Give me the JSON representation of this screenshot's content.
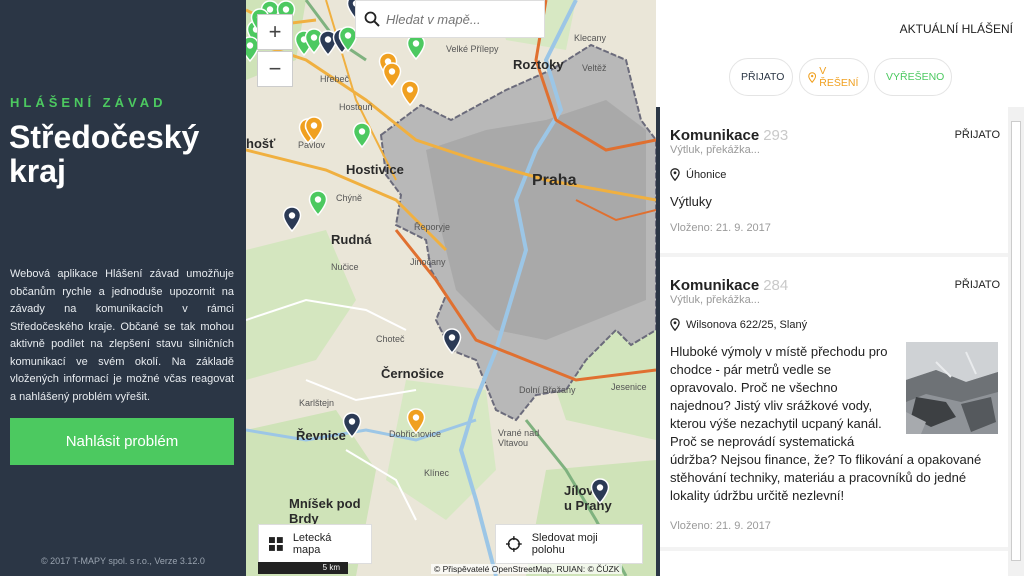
{
  "left": {
    "subtitle": "HLÁŠENÍ ZÁVAD",
    "title": "Středočeský kraj",
    "description": "Webová aplikace Hlášení závad umožňuje občanům rychle a jednoduše upozornit na závady na komunikacích v rámci Středočeského kraje. Občané se tak mohou aktivně podílet na zlepšení stavu silničních komunikací ve svém okolí. Na základě vložených informací je možné včas reagovat a nahlášený problém vyřešit.",
    "report_button": "Nahlásit problém",
    "footer": "© 2017 T-MAPY spol. s r.o., Verze 3.12.0"
  },
  "map": {
    "search_placeholder": "Hledat v mapě...",
    "zoom_in": "+",
    "zoom_out": "−",
    "aerial_button": "Letecká mapa",
    "locate_button": "Sledovat moji polohu",
    "scale": "5 km",
    "attribution": "© Přispěvatelé OpenStreetMap, RUIAN: © ČÚZK",
    "labels": {
      "praha": "Praha",
      "roztoky": "Roztoky",
      "hostivice": "Hostivice",
      "rudna": "Rudná",
      "cernosice": "Černošice",
      "revnice": "Řevnice",
      "mnisek": "Mníšek pod Brdy",
      "jilove": "Jílové u Prahy",
      "hostoun": "hošť",
      "klecany": "Klecany",
      "veltez": "Veltěž",
      "hrebec": "Hřebeč",
      "pavlov": "Pavlov",
      "chyne": "Chýně",
      "nucice": "Nučice",
      "jinocany": "Jinočany",
      "chotec": "Choteč",
      "karlstejn": "Karlštejn",
      "dobrichovice": "Dobřichovice",
      "vrane": "Vrané nad Vltavou",
      "klinec": "Klínec",
      "jesenice": "Jesenice",
      "dolni_brezany": "Dolní Břežany",
      "hostivice_small": "Hostouň",
      "velke_prilepy": "Velké Přílepy",
      "drastany": "Řeporyje"
    }
  },
  "right": {
    "header": "AKTUÁLNÍ HLÁŠENÍ",
    "filters": {
      "prijato": "PŘIJATO",
      "v_reseni": "V ŘEŠENÍ",
      "vyreseno": "VYŘEŠENO"
    },
    "reports": [
      {
        "title": "Komunikace",
        "number": "293",
        "subtitle": "Výtluk, překážka...",
        "status": "PŘIJATO",
        "location": "Úhonice",
        "text": "Výtluky",
        "date": "Vloženo: 21. 9. 2017"
      },
      {
        "title": "Komunikace",
        "number": "284",
        "subtitle": "Výtluk, překážka...",
        "status": "PŘIJATO",
        "location": "Wilsonova 622/25, Slaný",
        "text": "Hluboké výmoly v místě přechodu pro chodce - pár metrů vedle se opravovalo. Proč ne všechno najednou? Jistý vliv srážkové vody, kterou výše nezachytil ucpaný kanál. Proč se neprovádí systematická údržba? Nejsou finance, že? To flikování a opakované stěhování techniky, materiáu a pracovníků do jedné lokality údržbu určitě nezlevní!",
        "date": "Vloženo: 21. 9. 2017"
      }
    ]
  },
  "colors": {
    "sidebar": "#2b3645",
    "accent_green": "#4cc960",
    "pin_orange": "#f0a020",
    "pin_navy": "#2b3a55"
  }
}
